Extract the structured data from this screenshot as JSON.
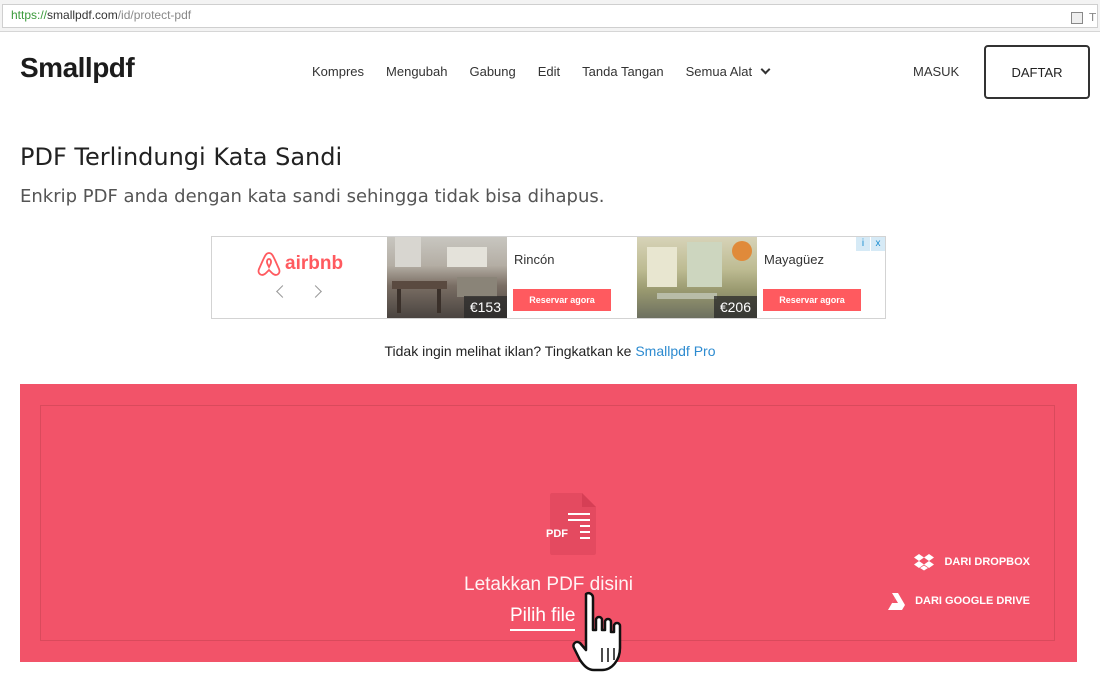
{
  "browser": {
    "url_proto": "https://",
    "url_host": "smallpdf.com",
    "url_path": "/id/protect-pdf",
    "ext_letter": "T"
  },
  "header": {
    "logo": "Smallpdf",
    "nav": [
      "Kompres",
      "Mengubah",
      "Gabung",
      "Edit",
      "Tanda Tangan",
      "Semua Alat"
    ],
    "login": "MASUK",
    "signup": "DAFTAR"
  },
  "page": {
    "title": "PDF Terlindungi Kata Sandi",
    "subtitle": "Enkrip PDF anda dengan kata sandi sehingga tidak bisa dihapus."
  },
  "ad": {
    "brand": "airbnb",
    "listings": [
      {
        "city": "Rincón",
        "price": "€153",
        "cta": "Reservar agora"
      },
      {
        "city": "Mayagüez",
        "price": "€206",
        "cta": "Reservar agora"
      }
    ],
    "badge": [
      "i",
      "x"
    ]
  },
  "upgrade": {
    "text": "Tidak ingin melihat iklan? Tingkatkan ke ",
    "link": "Smallpdf Pro"
  },
  "dropzone": {
    "icon_label": "PDF",
    "drop_text": "Letakkan PDF disini",
    "pick_file": "Pilih file",
    "dropbox": "DARI DROPBOX",
    "gdrive": "DARI GOOGLE DRIVE"
  },
  "colors": {
    "accent": "#f25369",
    "airbnb": "#ff5a5f",
    "link": "#2d8bd0"
  }
}
